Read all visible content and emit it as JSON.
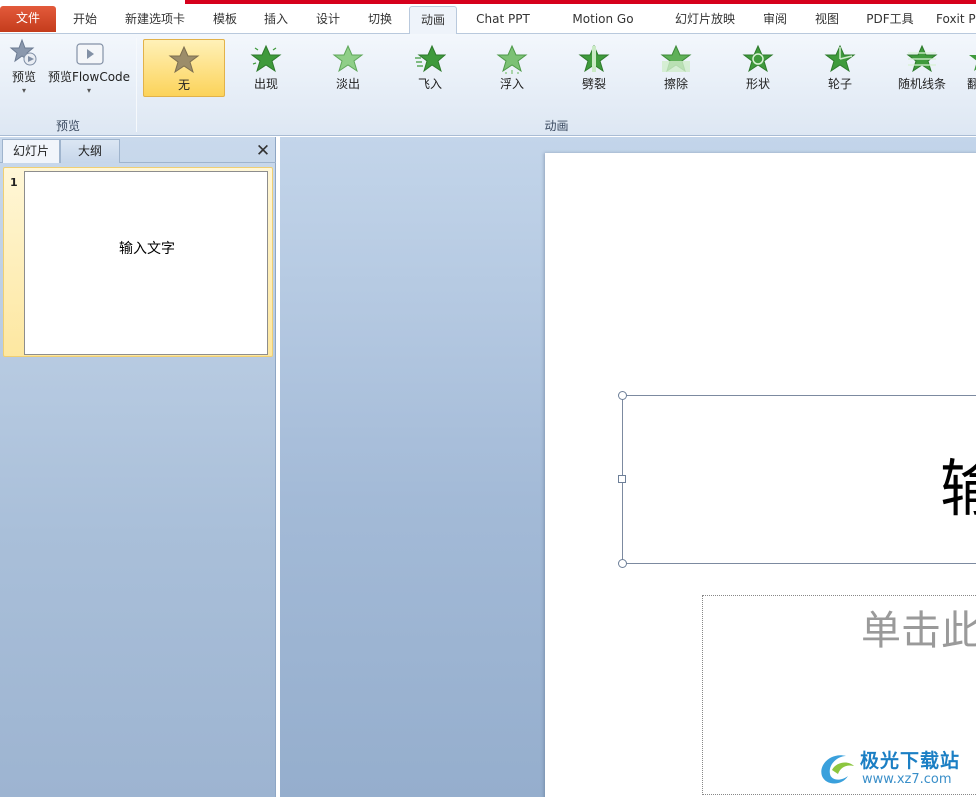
{
  "tabs": [
    "文件",
    "开始",
    "新建选项卡",
    "模板",
    "插入",
    "设计",
    "切换",
    "动画",
    "Chat PPT",
    "Motion Go",
    "幻灯片放映",
    "审阅",
    "视图",
    "PDF工具",
    "Foxit P"
  ],
  "active_tab": "动画",
  "preview_group": {
    "preview_label": "预览",
    "flowcode_label": "预览FlowCode",
    "group_label": "预览"
  },
  "animation_group": {
    "group_label": "动画",
    "items": [
      "无",
      "出现",
      "淡出",
      "飞入",
      "浮入",
      "劈裂",
      "擦除",
      "形状",
      "轮子",
      "随机线条",
      "翻"
    ],
    "selected": "无"
  },
  "panel": {
    "tab_slides": "幻灯片",
    "tab_outline": "大纲",
    "close_glyph": "✕",
    "slide_number": "1",
    "slide_text": "输入文字"
  },
  "slide": {
    "title_text": "输",
    "subtitle_text": "单击此"
  },
  "watermark": {
    "title": "极光下载站",
    "url": "www.xz7.com"
  },
  "colors": {
    "accent_red": "#d6001c",
    "file_tab": "#d24726",
    "selected_anim": "#fcd35a",
    "star_green": "#3f9a3c"
  }
}
